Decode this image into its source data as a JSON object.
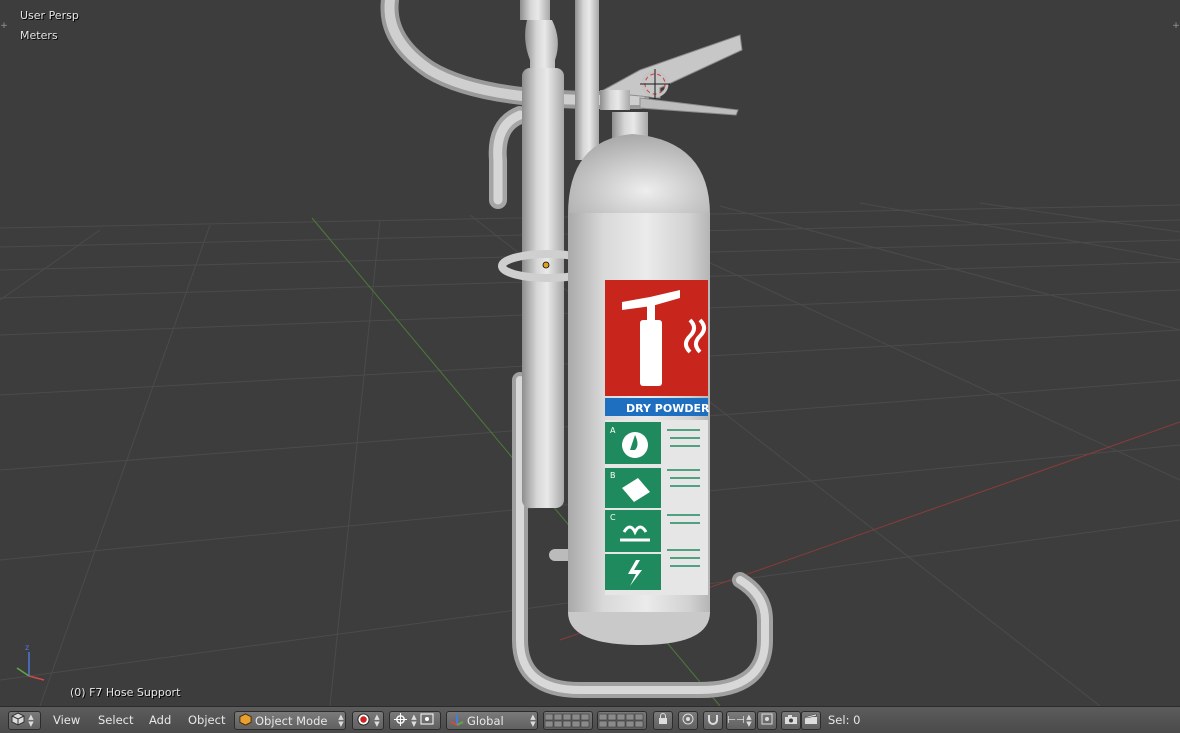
{
  "viewport": {
    "view_name": "User Persp",
    "units": "Meters",
    "object_info": "(0) F7 Hose Support"
  },
  "extinguisher_label": {
    "type_text": "DRY POWDER",
    "classes": [
      "A",
      "B",
      "C"
    ]
  },
  "header": {
    "editor_icon": "cube-icon",
    "menus": {
      "view": "View",
      "select": "Select",
      "add": "Add",
      "object": "Object"
    },
    "mode": "Object Mode",
    "orientation": "Global",
    "selection": "Sel: 0"
  },
  "colors": {
    "viewport_bg": "#3d3d3d",
    "grid": "#4a4a4a",
    "x_axis": "#8a3b3b",
    "y_axis": "#4d7a3b",
    "label_red": "#c8251d",
    "label_blue": "#1f6fc1",
    "label_green": "#1e8a5e"
  }
}
